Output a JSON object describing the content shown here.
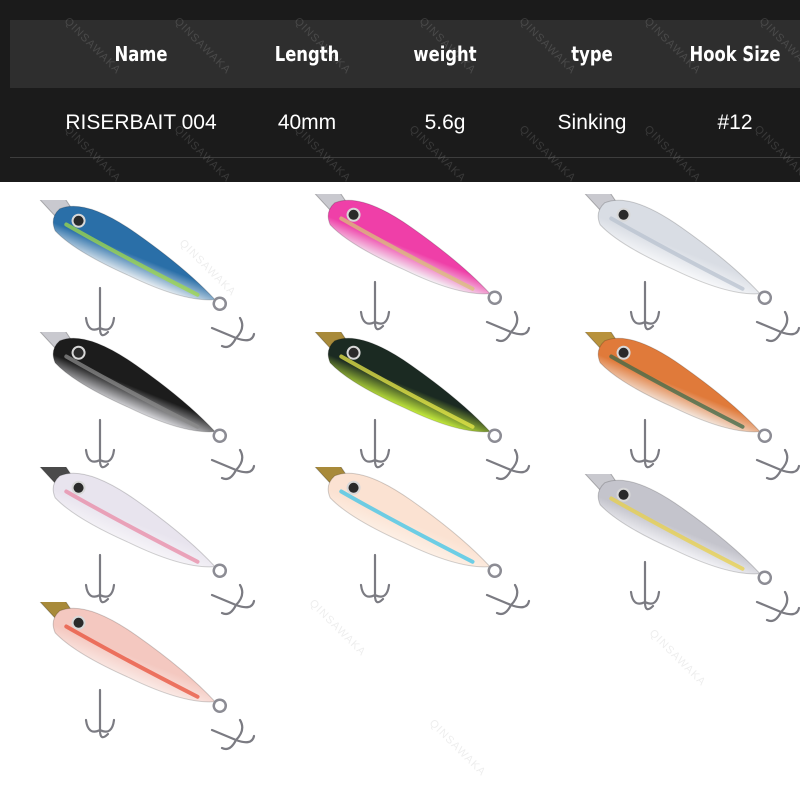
{
  "spec_table": {
    "headers": [
      "Name",
      "Length",
      "weight",
      "type",
      "Hook Size"
    ],
    "values": [
      "RISERBAIT 004",
      "40mm",
      "5.6g",
      "Sinking",
      "#12"
    ]
  },
  "watermark": "QINSAWAKA",
  "lures": [
    {
      "id": "blue-silver",
      "body": "#2a6fa8",
      "belly": "#e8eef2",
      "accent": "#9fd84a",
      "lip": "#c9c9cf"
    },
    {
      "id": "pink-trout",
      "body": "#ef3fa8",
      "belly": "#f4f4f6",
      "accent": "#d8c07a",
      "lip": "#c9c9cf"
    },
    {
      "id": "clear-ghost",
      "body": "#d9dde4",
      "belly": "#f7f8fa",
      "accent": "#b8c2cf",
      "lip": "#c9c9cf"
    },
    {
      "id": "black-silver-logo",
      "body": "#1c1c1c",
      "belly": "#d8d8dc",
      "accent": "#8a8a8a",
      "lip": "#c9c9cf"
    },
    {
      "id": "chartreuse-black-logo",
      "body": "#1b2a22",
      "belly": "#c7ee3c",
      "accent": "#e8e84a",
      "lip": "#a88a3a"
    },
    {
      "id": "clear-orange",
      "body": "#e07a3a",
      "belly": "#f3e6dc",
      "accent": "#3c6a4a",
      "lip": "#b8923c"
    },
    {
      "id": "clear-pink-head",
      "body": "#e8e4ee",
      "belly": "#f6f4f8",
      "accent": "#e88aa6",
      "lip": "#4a4a4a"
    },
    {
      "id": "peach-candy-dots",
      "body": "#fbe2d2",
      "belly": "#fdf0e6",
      "accent": "#3ec4e8",
      "lip": "#a88a3a"
    },
    {
      "id": "rainbow-silver",
      "body": "#c4c4cc",
      "belly": "#f2f2f6",
      "accent": "#e8d04a",
      "lip": "#c9c9cf"
    },
    {
      "id": "clear-orange-flake",
      "body": "#f4c8c0",
      "belly": "#faeae6",
      "accent": "#e8503a",
      "lip": "#a88a3a"
    }
  ]
}
